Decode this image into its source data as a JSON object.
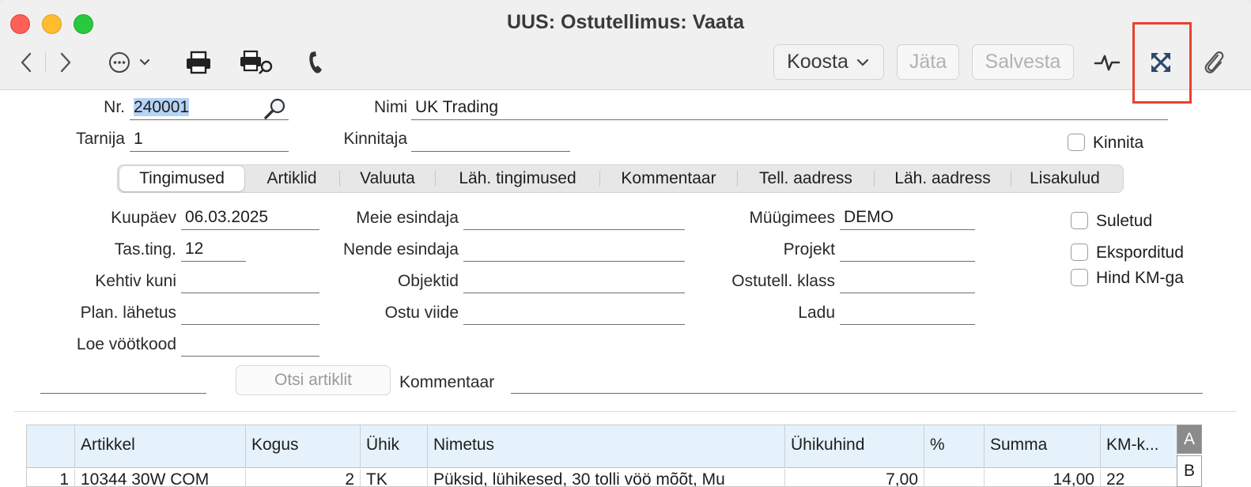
{
  "window": {
    "title": "UUS: Ostutellimus: Vaata"
  },
  "toolbar": {
    "icons": [
      "back-icon",
      "forward-icon",
      "more-icon",
      "printer-icon",
      "print-preview-icon",
      "phone-icon",
      "activity-icon",
      "expand-icon",
      "paperclip-icon"
    ],
    "koosta_label": "Koosta",
    "jata_label": "Jäta",
    "salvesta_label": "Salvesta"
  },
  "header": {
    "nr_label": "Nr.",
    "nr_value": "240001",
    "nimi_label": "Nimi",
    "nimi_value": "UK Trading",
    "tarnija_label": "Tarnija",
    "tarnija_value": "1",
    "kinnitaja_label": "Kinnitaja",
    "kinnitaja_value": "",
    "kinnita_label": "Kinnita"
  },
  "tabs": [
    "Tingimused",
    "Artiklid",
    "Valuuta",
    "Läh. tingimused",
    "Kommentaar",
    "Tell. aadress",
    "Läh. aadress",
    "Lisakulud"
  ],
  "terms": {
    "kuupaev_label": "Kuupäev",
    "kuupaev_value": "06.03.2025",
    "tasting_label": "Tas.ting.",
    "tasting_value": "12",
    "kehtiv_label": "Kehtiv kuni",
    "kehtiv_value": "",
    "planlahetus_label": "Plan. lähetus",
    "planlahetus_value": "",
    "loe_label": "Loe vöötkood",
    "loe_value": "",
    "meie_label": "Meie esindaja",
    "meie_value": "",
    "nende_label": "Nende esindaja",
    "nende_value": "",
    "objektid_label": "Objektid",
    "objektid_value": "",
    "ostuviide_label": "Ostu viide",
    "ostuviide_value": "",
    "myygimees_label": "Müügimees",
    "myygimees_value": "DEMO",
    "projekt_label": "Projekt",
    "projekt_value": "",
    "klass_label": "Ostutell. klass",
    "klass_value": "",
    "ladu_label": "Ladu",
    "ladu_value": "",
    "suletud_label": "Suletud",
    "eksporditud_label": "Eksporditud",
    "hindkm_label": "Hind KM-ga",
    "otsi_label": "Otsi artiklit",
    "kommentaar_label": "Kommentaar",
    "kommentaar_value": ""
  },
  "grid": {
    "columns": [
      "",
      "Artikkel",
      "Kogus",
      "Ühik",
      "Nimetus",
      "Ühikuhind",
      "%",
      "Summa",
      "KM-k..."
    ],
    "rows": [
      [
        "1",
        "10344 30W COM",
        "2",
        "TK",
        "Püksid, lühikesed, 30 tolli vöö mõõt, Mu",
        "7,00",
        "",
        "14,00",
        "22"
      ]
    ],
    "side_tabs": [
      "A",
      "B"
    ]
  }
}
